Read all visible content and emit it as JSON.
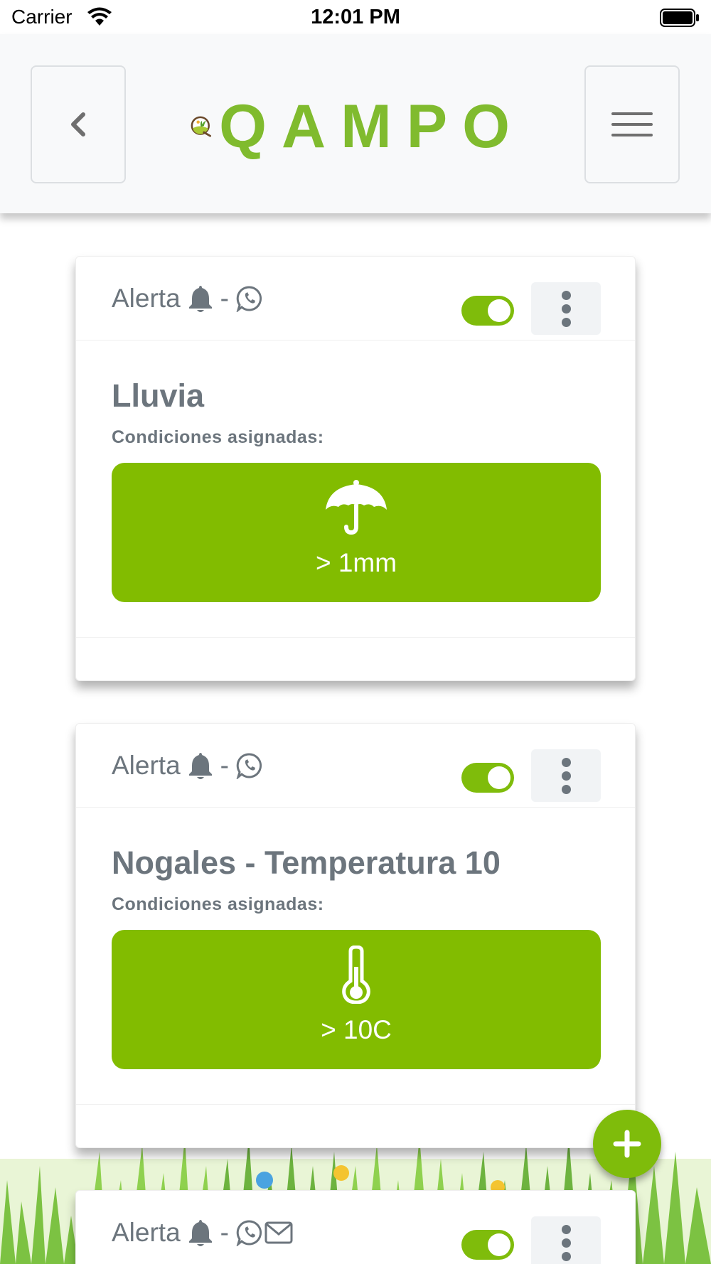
{
  "status_bar": {
    "carrier": "Carrier",
    "time": "12:01 PM"
  },
  "navbar": {
    "back_icon": "chevron-left-icon",
    "menu_icon": "hamburger-icon",
    "logo_text": "QAMPO",
    "colors": {
      "brand_green": "#80bb2e",
      "navbar_bg": "#f8f9fa"
    }
  },
  "cards": [
    {
      "header": {
        "label": "Alerta",
        "dash": "-",
        "channels": [
          "bell-icon",
          "whatsapp-icon"
        ],
        "enabled": true
      },
      "title": "Lluvia",
      "conditions_label": "Condiciones asignadas:",
      "condition": {
        "icon": "umbrella-icon",
        "value": "> 1mm"
      }
    },
    {
      "header": {
        "label": "Alerta",
        "dash": "-",
        "channels": [
          "bell-icon",
          "whatsapp-icon"
        ],
        "enabled": true
      },
      "title": "Nogales - Temperatura 10",
      "conditions_label": "Condiciones asignadas:",
      "condition": {
        "icon": "thermometer-icon",
        "value": "> 10C"
      }
    },
    {
      "header": {
        "label": "Alerta",
        "dash": "-",
        "channels": [
          "bell-icon",
          "whatsapp-icon",
          "envelope-icon"
        ],
        "enabled": true
      }
    }
  ],
  "fab": {
    "icon": "plus-icon"
  },
  "colors": {
    "accent": "#82bc00",
    "toggle_on": "#7fbc0b",
    "text_muted": "#6c757d"
  }
}
